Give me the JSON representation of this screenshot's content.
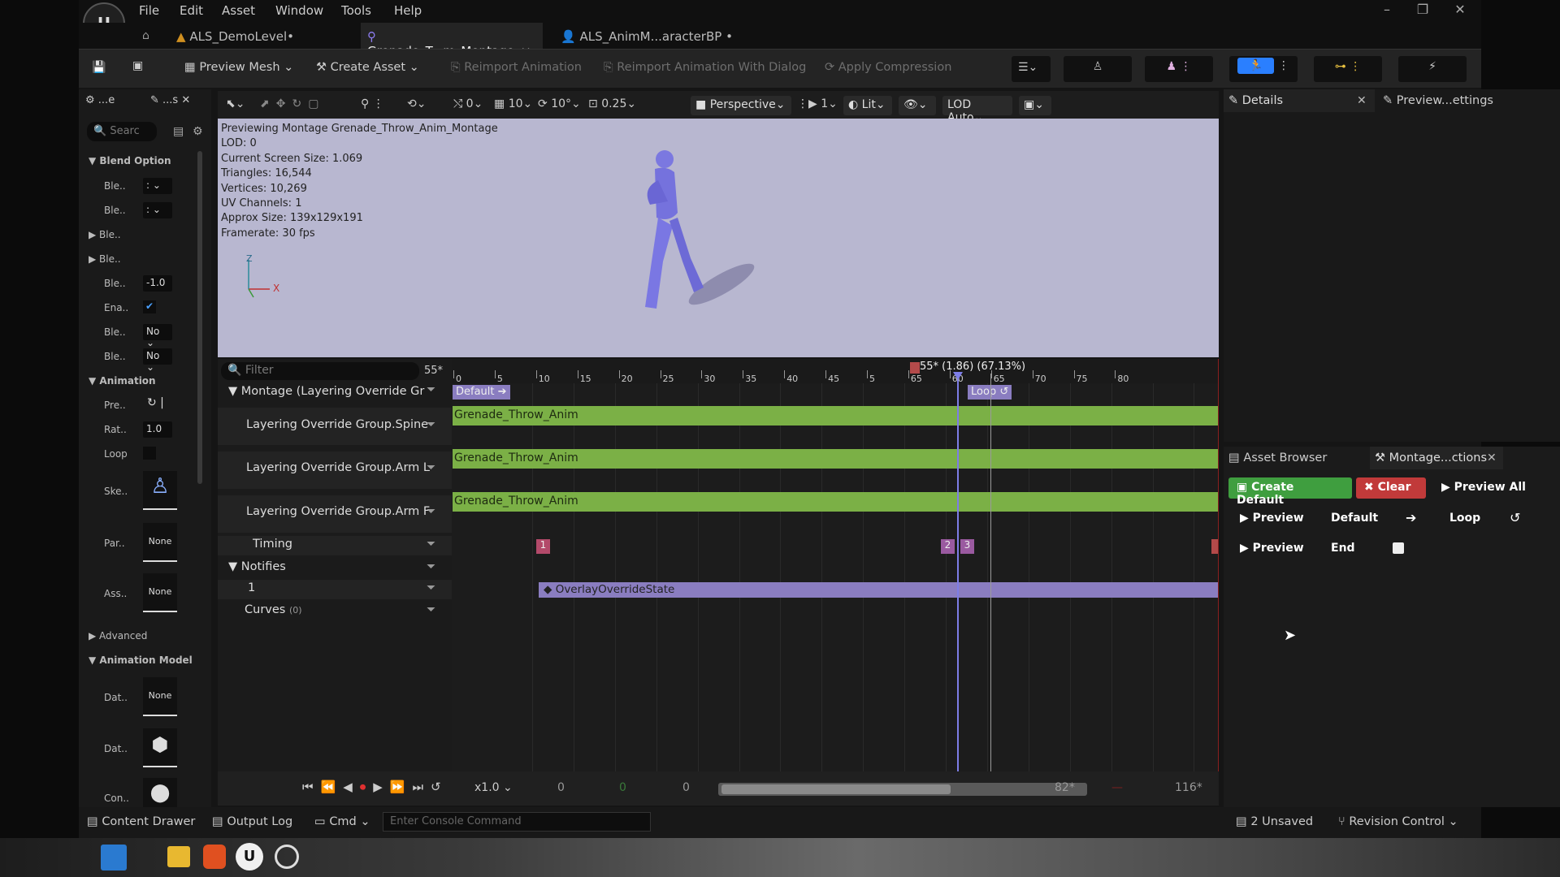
{
  "menu": [
    "File",
    "Edit",
    "Asset",
    "Window",
    "Tools",
    "Help"
  ],
  "tabs": [
    {
      "label": "ALS_DemoLevel•"
    },
    {
      "label": "Grenade_T...m_Montage",
      "close": "×"
    },
    {
      "label": "ALS_AnimM...aracterBP •"
    }
  ],
  "toolbar": {
    "preview_mesh": "Preview Mesh",
    "create_asset": "Create Asset",
    "reimport": "Reimport Animation",
    "reimport_dialog": "Reimport Animation With Dialog",
    "apply_compression": "Apply Compression"
  },
  "left_panel": {
    "tab1": "...e",
    "tab2": "...s",
    "search_placeholder": "Searc",
    "blend_option": "Blend Option",
    "rows": [
      "Ble..",
      "Ble..",
      "Ble..",
      "Ble..",
      "Ble..",
      "Ena..",
      "Ble..",
      "Ble.."
    ],
    "ble_value": "-1.0",
    "no_value": "No",
    "animation": "Animation",
    "pre": "Pre..",
    "rat": "Rat..",
    "rate_value": "1.0",
    "loop": "Loop",
    "ske": "Ske..",
    "par": "Par..",
    "ass": "Ass..",
    "none": "None",
    "advanced": "Advanced",
    "animation_model": "Animation Model",
    "dat1": "Dat..",
    "dat2": "Dat..",
    "con": "Con.."
  },
  "viewport": {
    "perspective": "Perspective",
    "lit": "Lit",
    "lod": "LOD Auto",
    "snap_grid": "10",
    "snap_rot": "10°",
    "snap_scale": "0.25",
    "cam_speed": "1",
    "zero": "0",
    "info": [
      "Previewing Montage Grenade_Throw_Anim_Montage",
      "LOD: 0",
      "Current Screen Size: 1.069",
      "Triangles: 16,544",
      "Vertices: 10,269",
      "UV Channels: 1",
      "Approx Size: 139x129x191",
      "Framerate: 30 fps"
    ],
    "axis_x": "X",
    "axis_z": "Z"
  },
  "sequencer": {
    "filter_placeholder": "Filter",
    "frame": "55*",
    "scrub_label": "55* (1.86) (67.13%)",
    "ruler": [
      "0",
      "5",
      "10",
      "15",
      "20",
      "25",
      "30",
      "35",
      "40",
      "45",
      "5",
      "65",
      "60",
      "65",
      "70",
      "75",
      "80"
    ],
    "tracks": {
      "montage": "Montage (Layering Override Gr",
      "spine": "Layering Override Group.Spine",
      "arml": "Layering Override Group.Arm L",
      "armr": "Layering Override Group.Arm F",
      "timing": "Timing",
      "notifies": "Notifies",
      "notify_track": "1",
      "curves": "Curves",
      "curves_count": "(0)"
    },
    "section_default": "Default",
    "section_loop": "Loop",
    "clip": "Grenade_Throw_Anim",
    "markers": [
      "1",
      "2",
      "3"
    ],
    "notify_state": "OverlayOverrideState"
  },
  "transport": {
    "speed": "x1.0",
    "v0": "0",
    "v1": "0",
    "v2": "0",
    "end_frame": "82*",
    "total": "116*"
  },
  "details": {
    "tab": "Details",
    "preview_tab": "Preview...ettings"
  },
  "montage_sections": {
    "asset_browser": "Asset Browser",
    "tab": "Montage...ctions",
    "create_default": "Create Default",
    "clear": "Clear",
    "preview_all": "Preview All",
    "preview": "Preview",
    "default": "Default",
    "loop": "Loop",
    "end": "End"
  },
  "statusbar": {
    "content_drawer": "Content Drawer",
    "output_log": "Output Log",
    "cmd": "Cmd",
    "console_placeholder": "Enter Console Command",
    "unsaved": "2 Unsaved",
    "revision": "Revision Control"
  },
  "colors": {
    "clip": "#7bb046",
    "accent": "#2a7fff",
    "create": "#3f9e3f",
    "clear": "#c13a3a",
    "marker": "#b34a6a"
  }
}
